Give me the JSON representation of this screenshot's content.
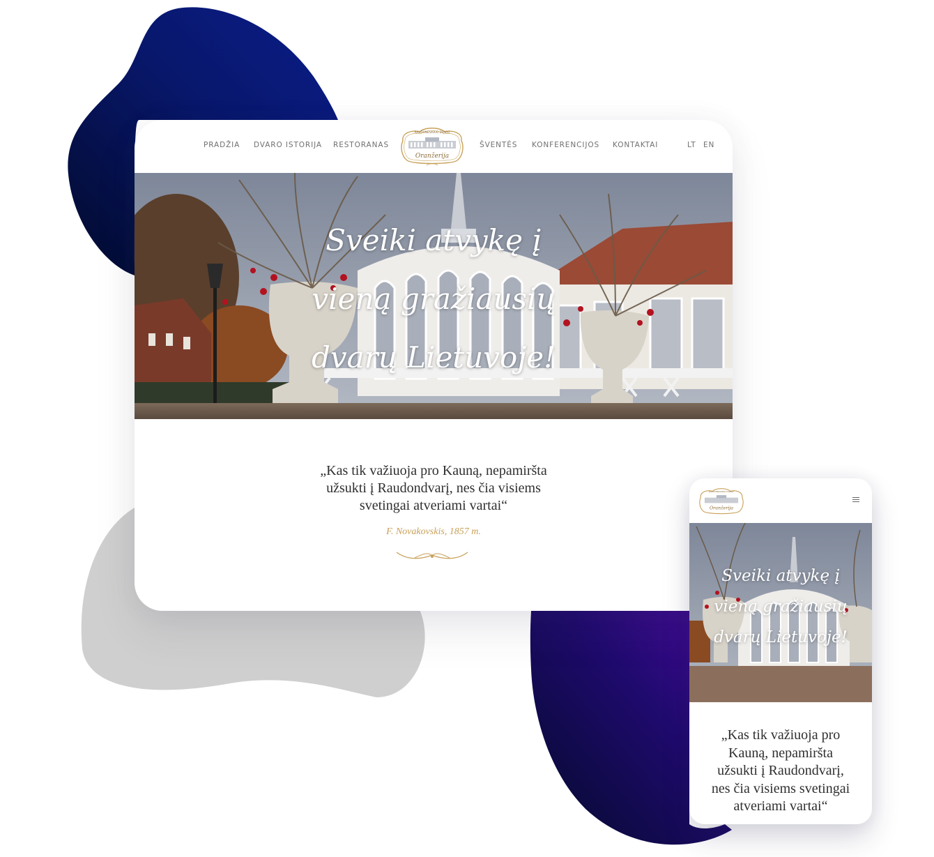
{
  "desktop": {
    "nav": {
      "items": [
        "PRADŽIA",
        "DVARO ISTORIJA",
        "RESTORANAS",
        "ŠVENTĖS",
        "KONFERENCIJOS",
        "KONTAKTAI"
      ],
      "lang": [
        "LT",
        "EN"
      ]
    },
    "logo": {
      "arc_text": "RAUDONDVARIO DVARO",
      "script_text": "Oranžerija"
    },
    "hero": {
      "lines": [
        "Sveiki atvykę į",
        "vieną gražiausių",
        "dvarų Lietuvoje!"
      ]
    },
    "quote": {
      "lines": [
        "„Kas tik važiuoja pro Kauną, nepamiršta",
        "užsukti į Raudondvarį, nes čia visiems",
        "svetingai atveriami vartai“"
      ],
      "attribution": "F. Novakovskis, 1857 m."
    }
  },
  "mobile": {
    "logo": {
      "arc_text": "RAUDONDVARIO DVARO",
      "script_text": "Oranžerija"
    },
    "hero": {
      "lines": [
        "Sveiki atvykę į",
        "vieną gražiausių",
        "dvarų Lietuvoje!"
      ]
    },
    "quote": {
      "lines": [
        "„Kas tik važiuoja pro",
        "Kauną, nepamiršta",
        "užsukti į Raudondvarį,",
        "nes čia visiems svetingai",
        "atveriami vartai“"
      ]
    }
  },
  "colors": {
    "blob_navy": "#0a1a6e",
    "blob_purple": "#3a0a8c",
    "blob_grey": "#cfcfcf",
    "accent_gold": "#c8a15a",
    "nav_text": "#707070"
  },
  "icons": [
    "hamburger-menu-icon",
    "gold-flourish-ornament",
    "manor-logo"
  ]
}
